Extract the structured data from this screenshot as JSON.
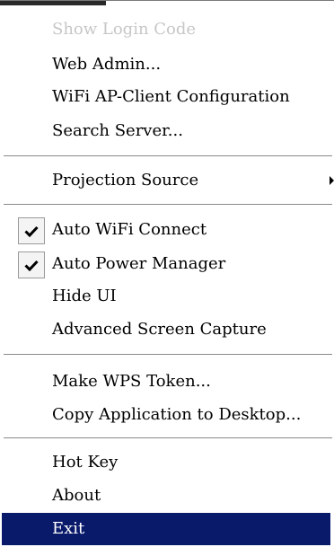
{
  "menu": {
    "items": [
      {
        "label": "Show Login Code",
        "disabled": true
      },
      {
        "label": "Web Admin..."
      },
      {
        "label": "WiFi AP-Client Configuration"
      },
      {
        "label": "Search Server..."
      },
      {
        "label": "Projection Source",
        "submenu": true
      },
      {
        "label": "Auto WiFi Connect",
        "checked": true
      },
      {
        "label": "Auto Power Manager",
        "checked": true
      },
      {
        "label": "Hide UI"
      },
      {
        "label": "Advanced Screen Capture"
      },
      {
        "label": "Make WPS Token..."
      },
      {
        "label": "Copy Application to Desktop..."
      },
      {
        "label": "Hot Key"
      },
      {
        "label": "About"
      },
      {
        "label": "Exit",
        "highlighted": true
      }
    ]
  },
  "colors": {
    "highlight_background": "#0a1a6b",
    "disabled_text": "#c7c7c7"
  },
  "icons": {
    "check": "checkmark-icon",
    "submenu": "submenu-arrow-icon"
  }
}
